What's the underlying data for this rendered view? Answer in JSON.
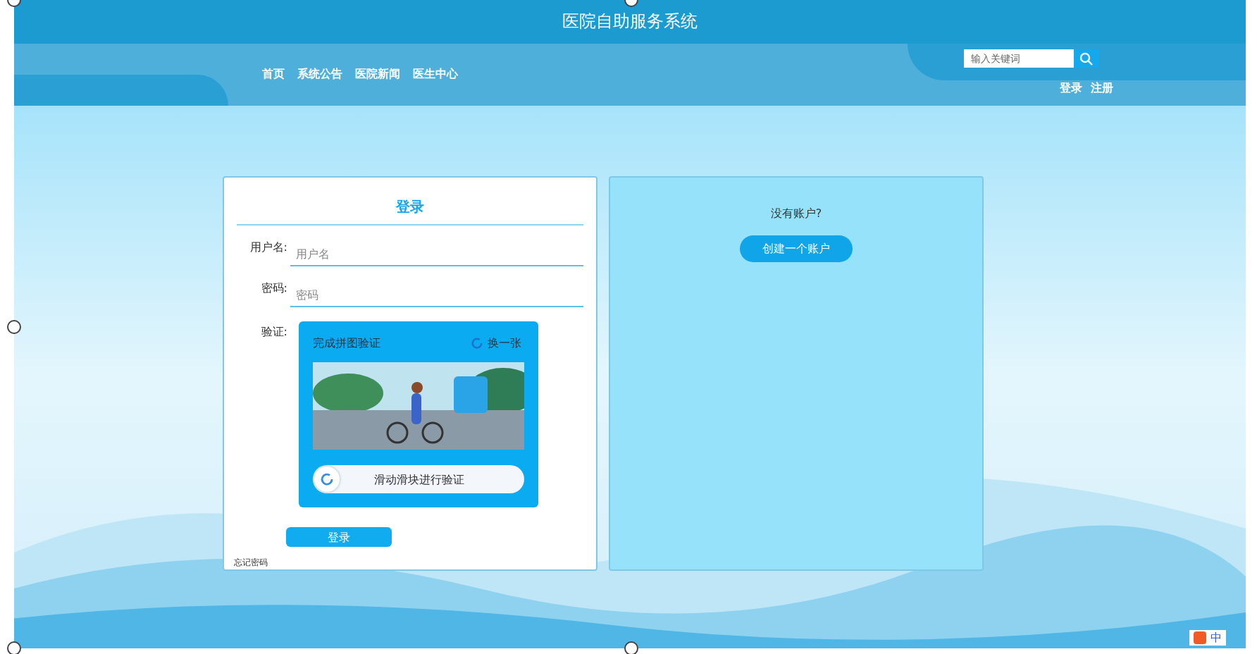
{
  "header": {
    "title": "医院自助服务系统",
    "nav": [
      {
        "label": "首页"
      },
      {
        "label": "系统公告"
      },
      {
        "label": "医院新闻"
      },
      {
        "label": "医生中心"
      }
    ],
    "search": {
      "placeholder": "输入关键词"
    },
    "auth_links": [
      {
        "label": "登录"
      },
      {
        "label": "注册"
      }
    ]
  },
  "login": {
    "title": "登录",
    "fields": [
      {
        "label": "用户名:",
        "placeholder": "用户名"
      },
      {
        "label": "密码:",
        "placeholder": "密码"
      }
    ],
    "captcha": {
      "label": "验证:",
      "title": "完成拼图验证",
      "refresh": "换一张",
      "slider": "滑动滑块进行验证"
    },
    "button": "登录",
    "forgot": "忘记密码"
  },
  "register": {
    "prompt": "没有账户?",
    "button": "创建一个账户"
  },
  "ime": {
    "mode": "中"
  }
}
